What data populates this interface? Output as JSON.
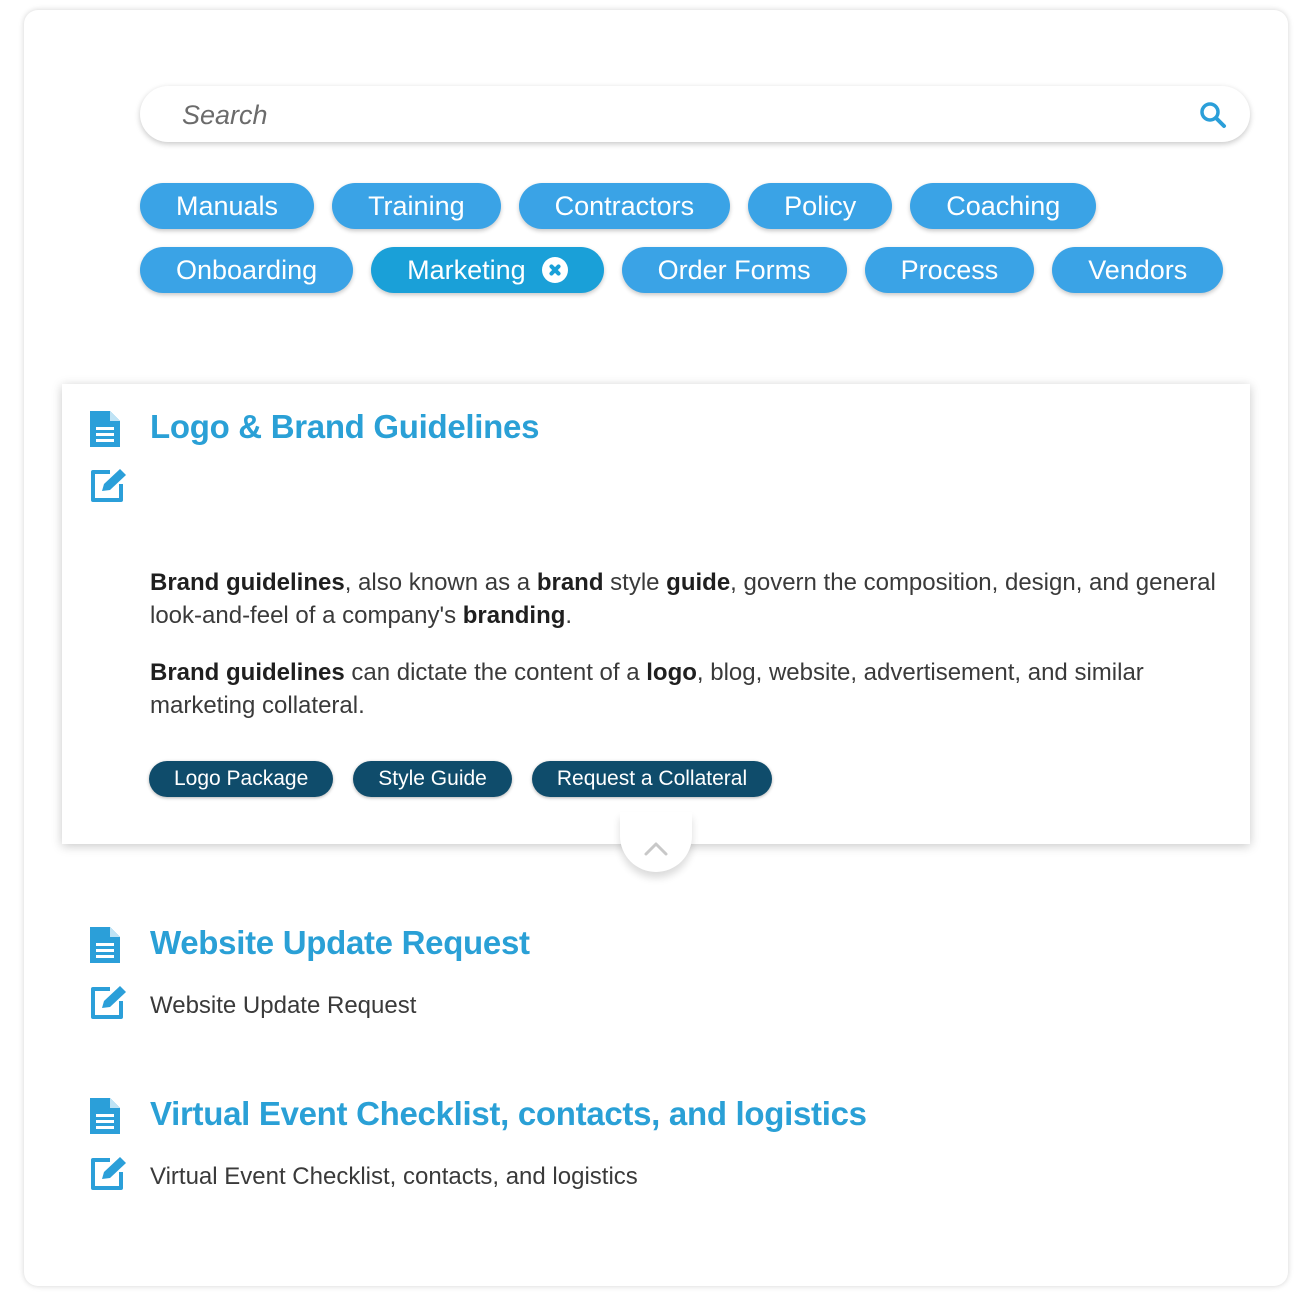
{
  "search": {
    "placeholder": "Search",
    "icon": "search-icon"
  },
  "filters": {
    "row1": [
      "Manuals",
      "Training",
      "Contractors",
      "Policy",
      "Coaching"
    ],
    "row2": [
      "Onboarding",
      "Marketing",
      "Order Forms",
      "Process",
      "Vendors"
    ],
    "active": "Marketing",
    "color": "#3aa3e6"
  },
  "results": [
    {
      "title": "Logo & Brand Guidelines",
      "expanded": true,
      "paragraph1": {
        "b1": "Brand guidelines",
        "t1": ", also known as a ",
        "b2": "brand",
        "t2": " style ",
        "b3": "guide",
        "t3": ", govern the composition, design, and general look-and-feel of a company's ",
        "b4": "branding",
        "t4": "."
      },
      "paragraph2": {
        "b1": "Brand guidelines",
        "t1": " can dictate the content of a ",
        "b2": "logo",
        "t2": ", blog, website, advertisement, and similar marketing collateral."
      },
      "links": [
        "Logo Package",
        "Style Guide",
        "Request a Collateral"
      ]
    },
    {
      "title": "Website Update Request",
      "subtitle": "Website Update Request"
    },
    {
      "title": "Virtual Event Checklist, contacts, and logistics",
      "subtitle": "Virtual Event Checklist, contacts, and logistics"
    }
  ],
  "colors": {
    "accent": "#2aa0d6",
    "chip": "#0f4c6b",
    "icon": "#2b9fd9"
  }
}
